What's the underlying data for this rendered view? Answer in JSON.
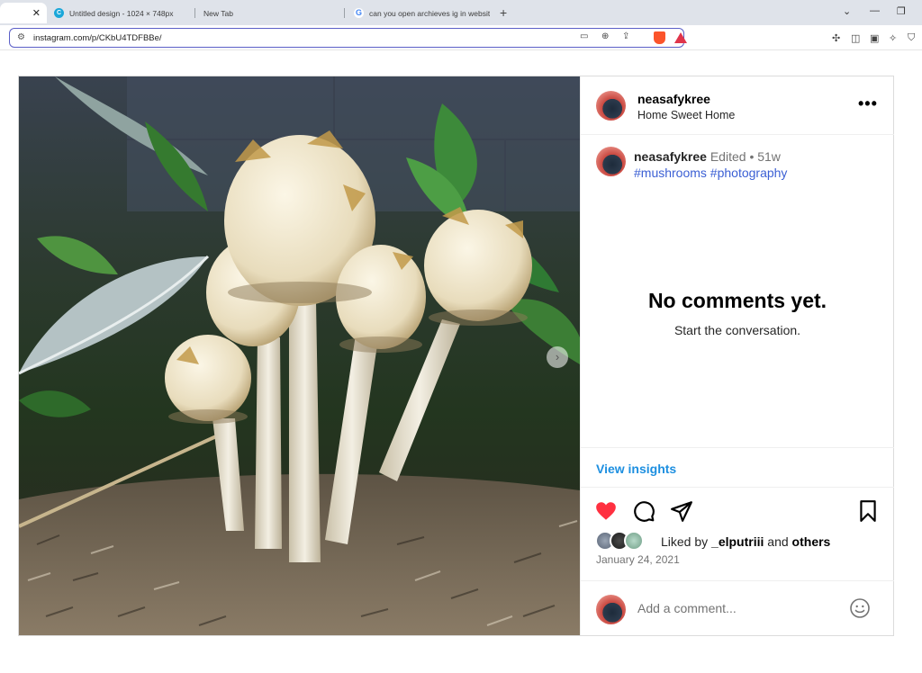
{
  "browser": {
    "tabs": [
      {
        "label": "",
        "active": true
      },
      {
        "label": "Untitled design - 1024 × 748px",
        "active": false
      },
      {
        "label": "New Tab",
        "active": false
      },
      {
        "label": "can you open archieves ig in websit",
        "active": false
      }
    ],
    "url": "instagram.com/p/CKbU4TDFBBe/",
    "favicon_canva": "C",
    "favicon_google": "G"
  },
  "post": {
    "header": {
      "username": "neasafykree",
      "location": "Home Sweet Home",
      "more_label": "•••"
    },
    "caption": {
      "username": "neasafykree",
      "edited": "Edited",
      "dot": "•",
      "age": "51w",
      "hashtags": "#mushrooms #photography"
    },
    "comments": {
      "empty_title": "No comments yet.",
      "empty_subtitle": "Start the conversation."
    },
    "insights_label": "View insights",
    "liked": true,
    "likes": {
      "prefix": "Liked by",
      "user": "_elputriii",
      "connector": "and",
      "others": "others"
    },
    "date": "January 24, 2021",
    "comment_placeholder": "Add a comment...",
    "colors": {
      "heart": "#ff3040",
      "link_blue": "#1d8fe0",
      "hashtag_blue": "#3b5fd4",
      "url_outline": "#5b5fc7"
    }
  }
}
